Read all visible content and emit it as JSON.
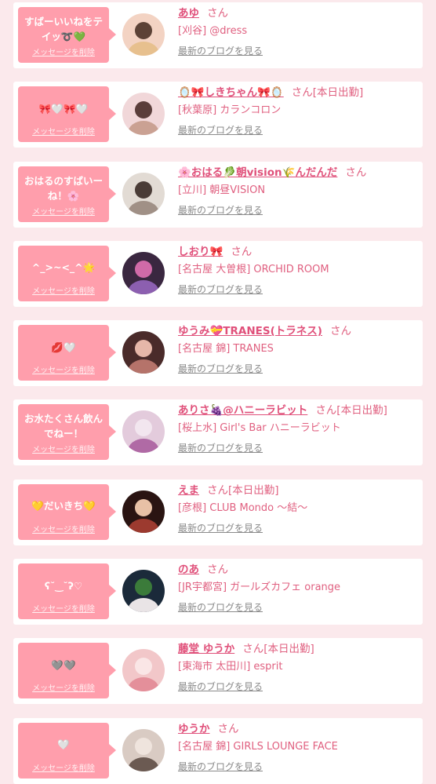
{
  "colors": {
    "page_bg": "#fbe9ec",
    "bubble": "#ff9eac",
    "name": "#e0507a",
    "shop": "#e06080",
    "blog_link": "#8a8a8a"
  },
  "labels": {
    "delete_message": "メッセージを削除",
    "blog_link": "最新のブログを見る"
  },
  "items": [
    {
      "message": "すばーいいねをテ\nイッ➰💚",
      "name": "あゆ",
      "suffix": "さん",
      "shop": "[刈谷] @dress",
      "avatar_colors": [
        "#f3d3c3",
        "#e7c08e",
        "#5c4236"
      ]
    },
    {
      "message": "🎀🤍🎀🤍",
      "name": "🪞🎀しきちゃん🎀🪞",
      "suffix": "さん[本日出勤]",
      "shop": "[秋葉原] カランコロン",
      "avatar_colors": [
        "#f1d7d9",
        "#caa193",
        "#5a3d3a"
      ]
    },
    {
      "message": "おはるのすばいー\nね！🌸",
      "name": "🌸おはる🥬朝vision🌾んだんだ",
      "suffix": "さん",
      "shop": "[立川] 朝昼VISION",
      "avatar_colors": [
        "#e2dbd4",
        "#a09086",
        "#4a3c37"
      ]
    },
    {
      "message": "^_>~<_^🌟",
      "name": "しおり🎀",
      "suffix": "さん",
      "shop": "[名古屋 大曽根] ORCHID ROOM",
      "avatar_colors": [
        "#3a2740",
        "#8c5fb0",
        "#d06aa8"
      ]
    },
    {
      "message": "💋🤍",
      "name": "ゆうみ💝TRANES(トラネス)",
      "suffix": "さん",
      "shop": "[名古屋 錦] TRANES",
      "avatar_colors": [
        "#4a2b2a",
        "#b5736a",
        "#e6b7a9"
      ]
    },
    {
      "message": "お水たくさん飲ん\nでねー！",
      "name": "ありさ🍇@ハニーラビット",
      "suffix": "さん[本日出勤]",
      "shop": "[桜上水] Girl's Bar ハニーラビット",
      "avatar_colors": [
        "#e3cbdc",
        "#b06aa5",
        "#f2e6ef"
      ]
    },
    {
      "message": "💛だいきち💛",
      "name": "えま",
      "suffix": "さん[本日出勤]",
      "shop": "[彦根] CLUB Mondo 〜結〜",
      "avatar_colors": [
        "#2a1412",
        "#9c3a2f",
        "#e8c1a6"
      ]
    },
    {
      "message": "ʕ˘‿˘ʔ♡",
      "name": "のあ",
      "suffix": "さん",
      "shop": "[JR宇都宮] ガールズカフェ orange",
      "avatar_colors": [
        "#1b2a3a",
        "#e9e4e6",
        "#3b7b3a"
      ]
    },
    {
      "message": "🩶🩶",
      "name": "藤堂 ゆうか",
      "suffix": "さん[本日出勤]",
      "shop": "[東海市 太田川] esprit",
      "avatar_colors": [
        "#f2c7c9",
        "#e48f9a",
        "#fae6e6"
      ]
    },
    {
      "message": "🤍",
      "name": "ゆうか",
      "suffix": "さん",
      "shop": "[名古屋 錦] GIRLS LOUNGE FACE",
      "avatar_colors": [
        "#d9cbc3",
        "#6b5a52",
        "#efe4dd"
      ]
    }
  ]
}
